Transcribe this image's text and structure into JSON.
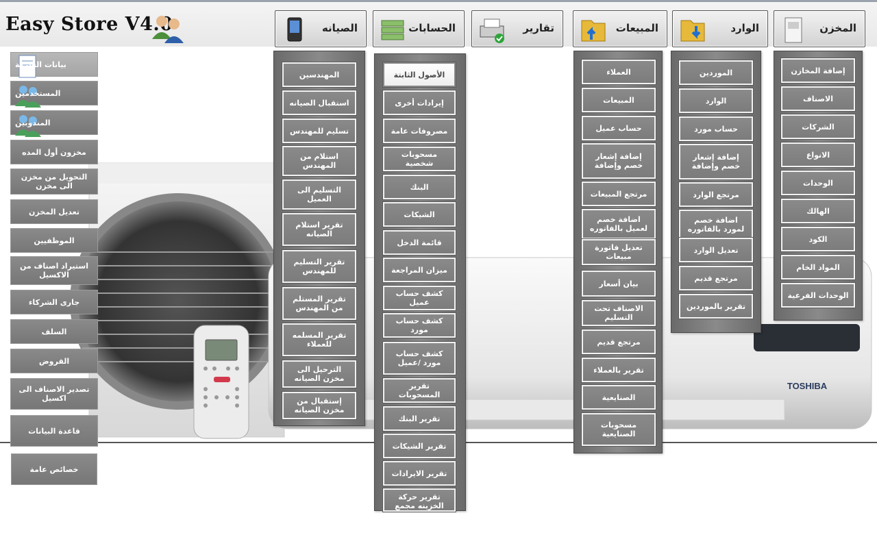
{
  "app": {
    "title": "Easy Store V4.0"
  },
  "tabs": [
    {
      "label": "المخزن",
      "icon": "storage-unit-icon"
    },
    {
      "label": "الوارد",
      "icon": "incoming-folder-icon"
    },
    {
      "label": "المبيعات",
      "icon": "sales-folder-icon"
    },
    {
      "label": "تقارير",
      "icon": "printer-icon"
    },
    {
      "label": "الحسابات",
      "icon": "money-stack-icon"
    },
    {
      "label": "الصيانه",
      "icon": "pda-device-icon"
    }
  ],
  "sidebar": [
    {
      "label": "بيانات الشركة",
      "icon": "document-icon"
    },
    {
      "label": "المستخدمين",
      "icon": "users-icon"
    },
    {
      "label": "المندوبين",
      "icon": "users-icon"
    },
    {
      "label": "مخزون أول المده"
    },
    {
      "label": "التحويل من مخزن الى مخزن"
    },
    {
      "label": "تعديل المخزن"
    },
    {
      "label": "الموظفيين"
    },
    {
      "label": "استيراد اصناف من الاكسيل"
    },
    {
      "label": "جارى الشركاء"
    },
    {
      "label": "السلف"
    },
    {
      "label": "القروض"
    },
    {
      "label": "تصدير الاصناف الى اكسيل"
    },
    {
      "label": "قاعدة البيانات"
    },
    {
      "label": "خصائص عامة"
    }
  ],
  "menus": {
    "store": [
      "إضافة المخازن",
      "الاصناف",
      "الشركات",
      "الانواع",
      "الوحدات",
      "الهالك",
      "الكود",
      "المواد الخام",
      "الوحدات الفرعية"
    ],
    "incoming": [
      "الموردين",
      "الوارد",
      "حساب مورد",
      "إضافة إشعار خصم وإضافة",
      "مرتجع الوارد",
      "اضافة خصم لمورد بالفاتوره",
      "تعديل الوارد",
      "مرتجع قديم",
      "تقرير بالموردين"
    ],
    "sales": [
      "العملاء",
      "المبيعات",
      "حساب عميل",
      "إضافة إشعار خصم وإضافة",
      "مرتجع المبيعات",
      "اضافة خصم لعميل بالفاتوره",
      "تعديل فاتورة مبيعات",
      "بيان أسعار",
      "الاصناف تحت التسليم",
      "مرتجع قديم",
      "تقرير بالعملاء",
      "الصنايعية",
      "مسحوبات الصنايعية"
    ],
    "accounts": [
      "الأصول الثابتة",
      "إيرادات أخرى",
      "مصروفات عامة",
      "مسحوبات شخصية",
      "البنك",
      "الشيكات",
      "قائمة الدخل",
      "ميزان المراجعة",
      "كشف حساب عميل",
      "كشف حساب مورد",
      "كشف حساب مورد /عميل",
      "تقرير المسحوبات",
      "تقرير البنك",
      "تقرير الشيكات",
      "تقرير الايرادات",
      "تقرير حركة الخزينه مجمع"
    ],
    "maintenance": [
      "المهندسين",
      "استقبال الصيانه",
      "تسليم للمهندس",
      "استلام من المهندس",
      "التسليم الى العميل",
      "تقرير استلام الصيانه",
      "تقرير التسليم للمهندس",
      "تقرير المستلم من المهندس",
      "تقرير المسلمه للعملاء",
      "الترحيل الى مخزن الصيانه",
      "إستقبال من مخزن الصيانه"
    ]
  },
  "background": {
    "brand": "TOSHIBA"
  },
  "colors": {
    "button": "#808080",
    "button_text": "#ffffff",
    "highlight": "#ffffff"
  }
}
